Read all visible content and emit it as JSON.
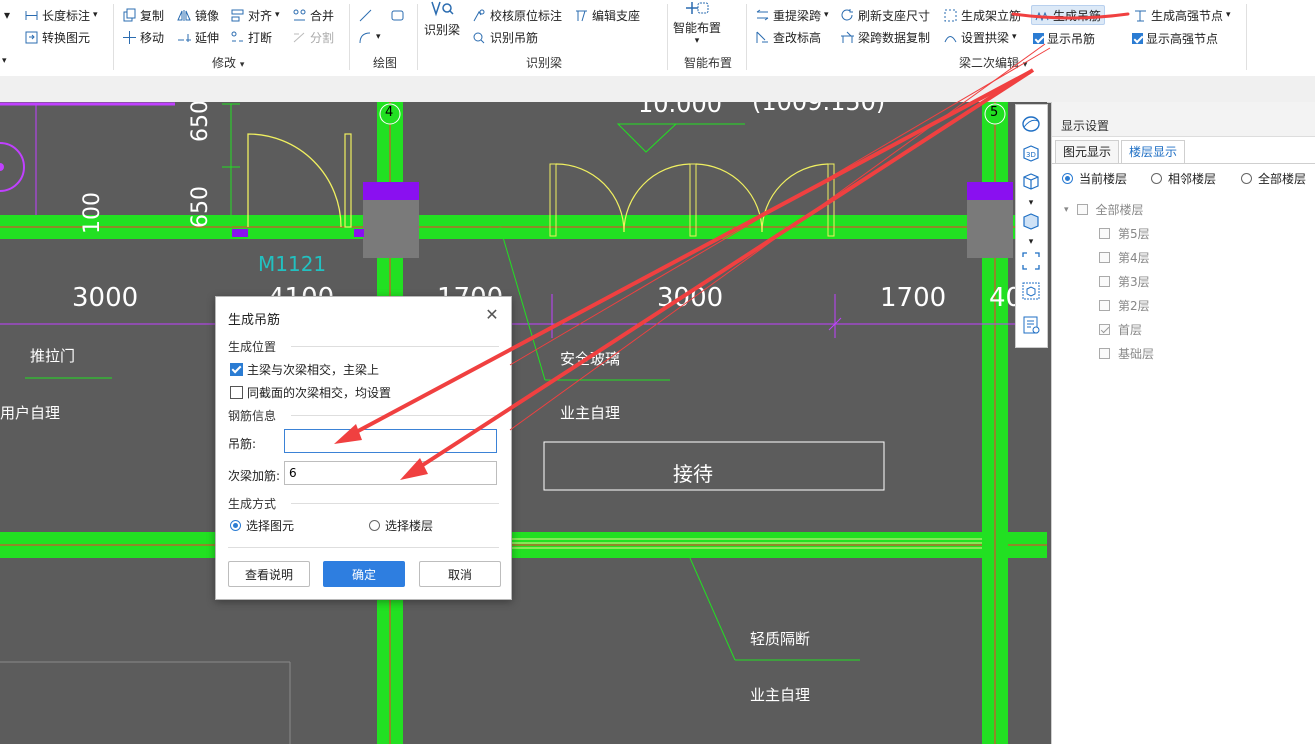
{
  "ribbon": {
    "left_fragment": {
      "length_mark": "长度标注",
      "convert": "转换图元"
    },
    "modify": {
      "copy": "复制",
      "mirror": "镜像",
      "align": "对齐",
      "merge": "合并",
      "move": "移动",
      "extend": "延伸",
      "break": "打断",
      "split": "分割",
      "group_label": "修改"
    },
    "draw": {
      "group_label": "绘图"
    },
    "recognize": {
      "recognize_beam": "识别梁",
      "check_label": "校核原位标注",
      "edit_support": "编辑支座",
      "recognize_hanger": "识别吊筋",
      "group_label": "识别梁"
    },
    "smart": {
      "smart_layout": "智能布置",
      "group_label": "智能布置"
    },
    "secondary": {
      "re_span": "重提梁跨",
      "refresh_support": "刷新支座尺寸",
      "gen_stirrup": "生成架立筋",
      "gen_hanger": "生成吊筋",
      "gen_strong_node": "生成高强节点",
      "modify_elev": "查改标高",
      "span_copy": "梁跨数据复制",
      "set_arch": "设置拱梁",
      "show_hanger": "显示吊筋",
      "show_strong_node": "显示高强节点",
      "group_label": "梁二次编辑"
    }
  },
  "cad": {
    "dims": [
      "3000",
      "4100",
      "1700",
      "3000",
      "1700",
      "40"
    ],
    "vert_dims": [
      "650",
      "650",
      "100"
    ],
    "axis_4": "4",
    "axis_5": "5",
    "elev": "10.000",
    "elev2": "(1009.150)",
    "door": "M1121",
    "texts": {
      "push_door": "推拉门",
      "user_self": "用户自理",
      "safety_glass": "安全玻璃",
      "owner_self": "业主自理",
      "reception": "接待",
      "partition": "轻质隔断",
      "owner_self2": "业主自理"
    }
  },
  "panel": {
    "title": "显示设置",
    "tabs": [
      "图元显示",
      "楼层显示"
    ],
    "radios": [
      "当前楼层",
      "相邻楼层",
      "全部楼层"
    ],
    "tree_root": "全部楼层",
    "floors": [
      {
        "label": "第5层",
        "checked": false
      },
      {
        "label": "第4层",
        "checked": false
      },
      {
        "label": "第3层",
        "checked": false
      },
      {
        "label": "第2层",
        "checked": false
      },
      {
        "label": "首层",
        "checked": true
      },
      {
        "label": "基础层",
        "checked": false
      }
    ]
  },
  "dialog": {
    "title": "生成吊筋",
    "sec_position": "生成位置",
    "opt_main_secondary": "主梁与次梁相交，主梁上",
    "opt_same_section": "同截面的次梁相交，均设置",
    "sec_rebar": "钢筋信息",
    "hanger_label": "吊筋:",
    "hanger_value": "",
    "secondary_label": "次梁加筋:",
    "secondary_value": "6",
    "sec_method": "生成方式",
    "radio_select_element": "选择图元",
    "radio_select_floor": "选择楼层",
    "btn_help": "查看说明",
    "btn_ok": "确定",
    "btn_cancel": "取消"
  },
  "colors": {
    "wall_green": "#22e022",
    "annotation_red": "#f04040",
    "primary_blue": "#2e7ee0"
  }
}
